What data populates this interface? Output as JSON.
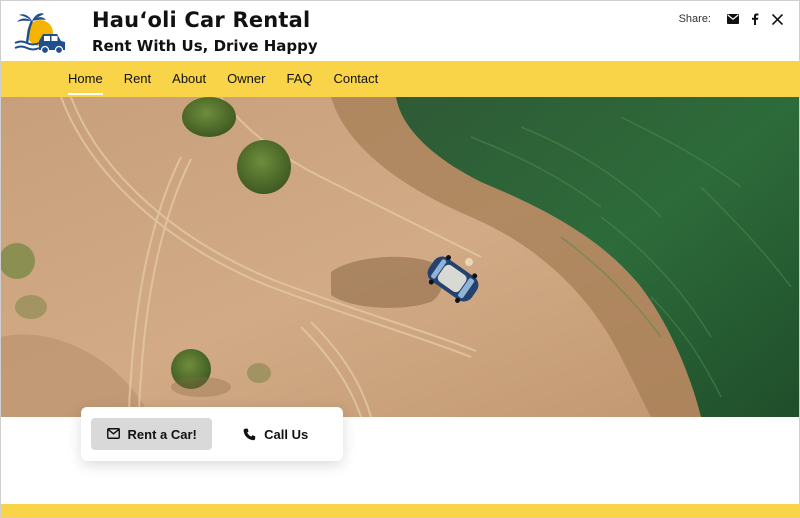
{
  "header": {
    "title": "Hau‘oli Car Rental",
    "tagline": "Rent With Us, Drive Happy",
    "logo_icon": "palm-car-logo",
    "share": {
      "label": "Share:",
      "icons": [
        "email-icon",
        "facebook-icon",
        "x-icon"
      ]
    }
  },
  "nav": {
    "items": [
      {
        "label": "Home",
        "active": true
      },
      {
        "label": "Rent",
        "active": false
      },
      {
        "label": "About",
        "active": false
      },
      {
        "label": "Owner",
        "active": false
      },
      {
        "label": "FAQ",
        "active": false
      },
      {
        "label": "Contact",
        "active": false
      }
    ]
  },
  "cta": {
    "rent_label": "Rent a Car!",
    "rent_icon": "envelope-icon",
    "call_label": "Call Us",
    "call_icon": "phone-icon"
  },
  "colors": {
    "accent_yellow": "#f9d449",
    "button_gray": "#d9d9d9",
    "logo_blue": "#1f4f8f",
    "logo_sun": "#f4b400"
  }
}
